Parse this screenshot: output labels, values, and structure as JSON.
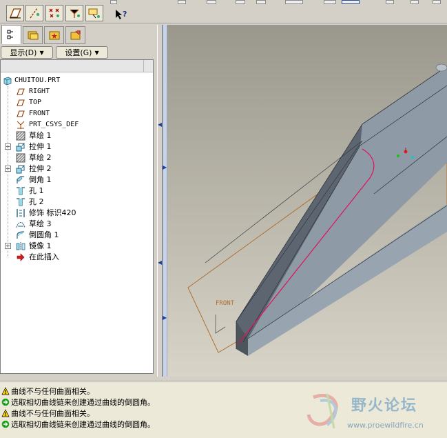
{
  "toolbar": {
    "buttons": [
      {
        "name": "plane-display-icon"
      },
      {
        "name": "axis-display-icon"
      },
      {
        "name": "point-display-icon"
      },
      {
        "name": "csys-display-icon"
      },
      {
        "name": "annotation-display-icon"
      }
    ],
    "help_icon": "whats-this-help-icon"
  },
  "tabs": [
    {
      "name": "model-tree-tab"
    },
    {
      "name": "folder-browser-tab"
    },
    {
      "name": "favorites-tab"
    },
    {
      "name": "connections-tab"
    }
  ],
  "menus": {
    "show_label": "显示(D)",
    "settings_label": "设置(G)"
  },
  "tree": {
    "root": "CHUITOU.PRT",
    "items": [
      {
        "label": "RIGHT",
        "icon": "datum-plane-icon",
        "expandable": false
      },
      {
        "label": "TOP",
        "icon": "datum-plane-icon",
        "expandable": false
      },
      {
        "label": "FRONT",
        "icon": "datum-plane-icon",
        "expandable": false
      },
      {
        "label": "PRT_CSYS_DEF",
        "icon": "csys-icon",
        "expandable": false
      },
      {
        "label": "草绘 1",
        "icon": "sketch-icon",
        "expandable": false
      },
      {
        "label": "拉伸 1",
        "icon": "extrude-icon",
        "expandable": true
      },
      {
        "label": "草绘 2",
        "icon": "sketch-icon",
        "expandable": false
      },
      {
        "label": "拉伸 2",
        "icon": "extrude-icon",
        "expandable": true
      },
      {
        "label": "倒角 1",
        "icon": "chamfer-icon",
        "expandable": false
      },
      {
        "label": "孔 1",
        "icon": "hole-icon",
        "expandable": false
      },
      {
        "label": "孔 2",
        "icon": "hole-icon",
        "expandable": false
      },
      {
        "label": "修饰 标识420",
        "icon": "cosmetic-icon",
        "expandable": false
      },
      {
        "label": "草绘 3",
        "icon": "sketch-curve-icon",
        "expandable": false
      },
      {
        "label": "倒圆角 1",
        "icon": "round-icon",
        "expandable": false
      },
      {
        "label": "镜像 1",
        "icon": "mirror-icon",
        "expandable": true
      },
      {
        "label": "在此插入",
        "icon": "insert-here-icon",
        "expandable": false
      }
    ]
  },
  "viewport": {
    "datum_label": "FRONT",
    "colors": {
      "background_top": "#9a978c",
      "background_bottom": "#d8d4c8",
      "model": "#8e9ba7",
      "highlight": "#e0105a",
      "datum": "#b07030"
    }
  },
  "messages": [
    {
      "type": "warning",
      "text": "曲线不与任何曲面相关。"
    },
    {
      "type": "prompt",
      "text": "选取相切曲线链来创建通过曲线的倒圆角。"
    },
    {
      "type": "warning",
      "text": "曲线不与任何曲面相关。"
    },
    {
      "type": "prompt",
      "text": "选取相切曲线链来创建通过曲线的倒圆角。"
    }
  ],
  "watermark": {
    "title": "野火论坛",
    "url": "www.proewildfire.cn"
  }
}
